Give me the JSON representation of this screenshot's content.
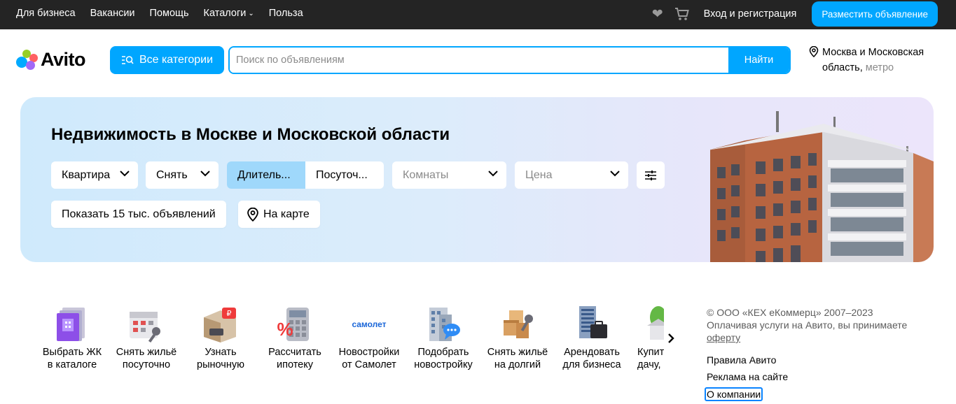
{
  "topbar": {
    "nav": [
      "Для бизнеса",
      "Вакансии",
      "Помощь",
      "Каталоги",
      "Польза"
    ],
    "login": "Вход и регистрация",
    "post_ad": "Разместить объявление"
  },
  "header": {
    "logo": "Avito",
    "categories_button": "Все категории",
    "search_placeholder": "Поиск по объявлениям",
    "search_button": "Найти",
    "location": "Москва и Московская область,",
    "metro": "метро"
  },
  "banner": {
    "title": "Недвижимость в Москве и Московской области",
    "type_select": "Квартира",
    "deal_select": "Снять",
    "term_long": "Длитель...",
    "term_daily": "Посуточ...",
    "rooms_placeholder": "Комнаты",
    "price_placeholder": "Цена",
    "show_button": "Показать 15 тыс. объявлений",
    "map_button": "На карте"
  },
  "shortcuts": [
    {
      "l1": "Выбрать ЖК",
      "l2": "в каталоге",
      "icon": "residential-complex-icon"
    },
    {
      "l1": "Снять жильё",
      "l2": "посуточно",
      "icon": "calendar-key-icon"
    },
    {
      "l1": "Узнать",
      "l2": "рыночную",
      "icon": "room-price-icon"
    },
    {
      "l1": "Рассчитать",
      "l2": "ипотеку",
      "icon": "calculator-icon"
    },
    {
      "l1": "Новостройки",
      "l2": "от Самолет",
      "logo": "самолет",
      "icon": "samolet-logo"
    },
    {
      "l1": "Подобрать",
      "l2": "новостройку",
      "icon": "building-chat-icon"
    },
    {
      "l1": "Снять жильё",
      "l2": "на долгий",
      "icon": "boxes-key-icon"
    },
    {
      "l1": "Арендовать",
      "l2": "для бизнеса",
      "icon": "building-briefcase-icon"
    },
    {
      "l1": "Купить",
      "l2": "дачу, к",
      "icon": "house-tree-icon"
    }
  ],
  "footer": {
    "copyright": "© ООО «КЕХ еКоммерц» 2007–2023",
    "terms_text": "Оплачивая услуги на Авито, вы принимаете",
    "offer_link": "оферту",
    "links": [
      "Правила Авито",
      "Реклама на сайте",
      "О компании"
    ]
  },
  "colors": {
    "accent": "#00a6ff",
    "topbar": "#242424",
    "segment_active": "#9fd8fb"
  }
}
